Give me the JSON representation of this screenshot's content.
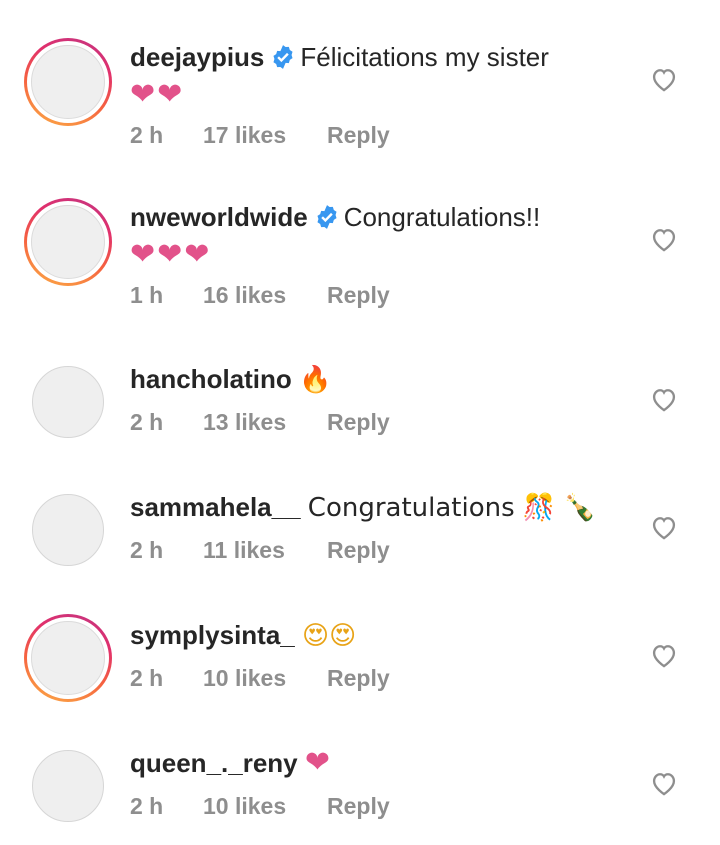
{
  "comments": [
    {
      "username": "deejaypius",
      "verified": true,
      "text": "Félicitations my sister",
      "emojis": "❤❤",
      "time": "2 h",
      "likes": "17 likes",
      "reply": "Reply",
      "ring": true
    },
    {
      "username": "nweworldwide",
      "verified": true,
      "text": "Congratulations!!",
      "emojis": "❤❤❤",
      "time": "1 h",
      "likes": "16 likes",
      "reply": "Reply",
      "ring": true
    },
    {
      "username": "hancholatino",
      "verified": false,
      "text": "🔥",
      "time": "2 h",
      "likes": "13 likes",
      "reply": "Reply",
      "ring": false
    },
    {
      "username": "sammahela__",
      "verified": false,
      "text": "Congratulations 🎊 🍾",
      "time": "2 h",
      "likes": "11 likes",
      "reply": "Reply",
      "ring": false
    },
    {
      "username": "symplysinta_",
      "verified": false,
      "text": "😍😍",
      "time": "2 h",
      "likes": "10 likes",
      "reply": "Reply",
      "ring": true
    },
    {
      "username": "queen_._reny",
      "verified": false,
      "text": "❤",
      "time": "2 h",
      "likes": "10 likes",
      "reply": "Reply",
      "ring": false
    }
  ],
  "colors": {
    "verified": "#3897f0",
    "heart": "#e2528a",
    "meta": "#8e8e8e",
    "ring": "#e1306c"
  }
}
